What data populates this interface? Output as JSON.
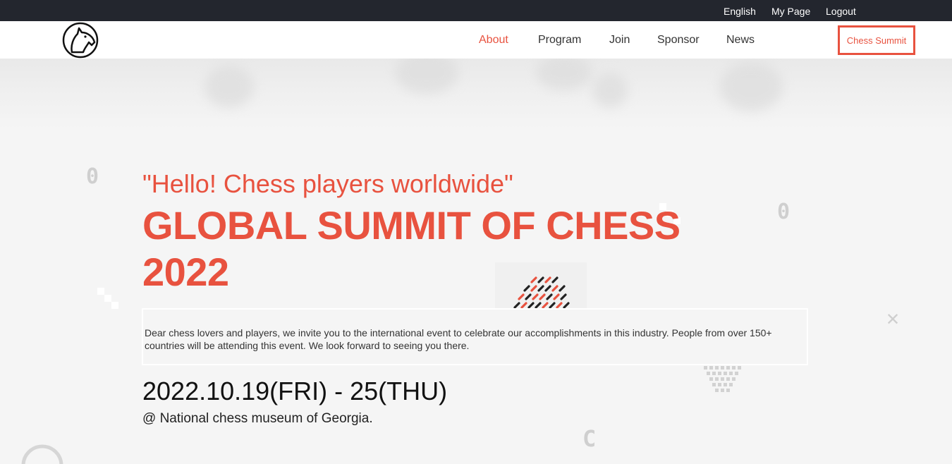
{
  "topbar": {
    "links": [
      "English",
      "My Page",
      "Logout"
    ]
  },
  "nav": {
    "logo": "knight-logo",
    "items": [
      "About",
      "Program",
      "Join",
      "Sponsor",
      "News"
    ],
    "active": "About",
    "cta_label": "Chess Summit"
  },
  "hero": {
    "quote": "\"Hello! Chess players worldwide\"",
    "title": "GLOBAL SUMMIT OF CHESS 2022",
    "description": "Dear chess lovers and players, we invite you to the international event to celebrate our accomplishments in this industry. People from over 150+ countries will be attending this event. We look forward to seeing you there.",
    "date": "2022.10.19(FRI) - 25(THU)",
    "venue": "@ National chess museum of Georgia."
  },
  "colors": {
    "accent": "#e8523f",
    "topbar": "#23262e",
    "background": "#f5f5f5"
  }
}
